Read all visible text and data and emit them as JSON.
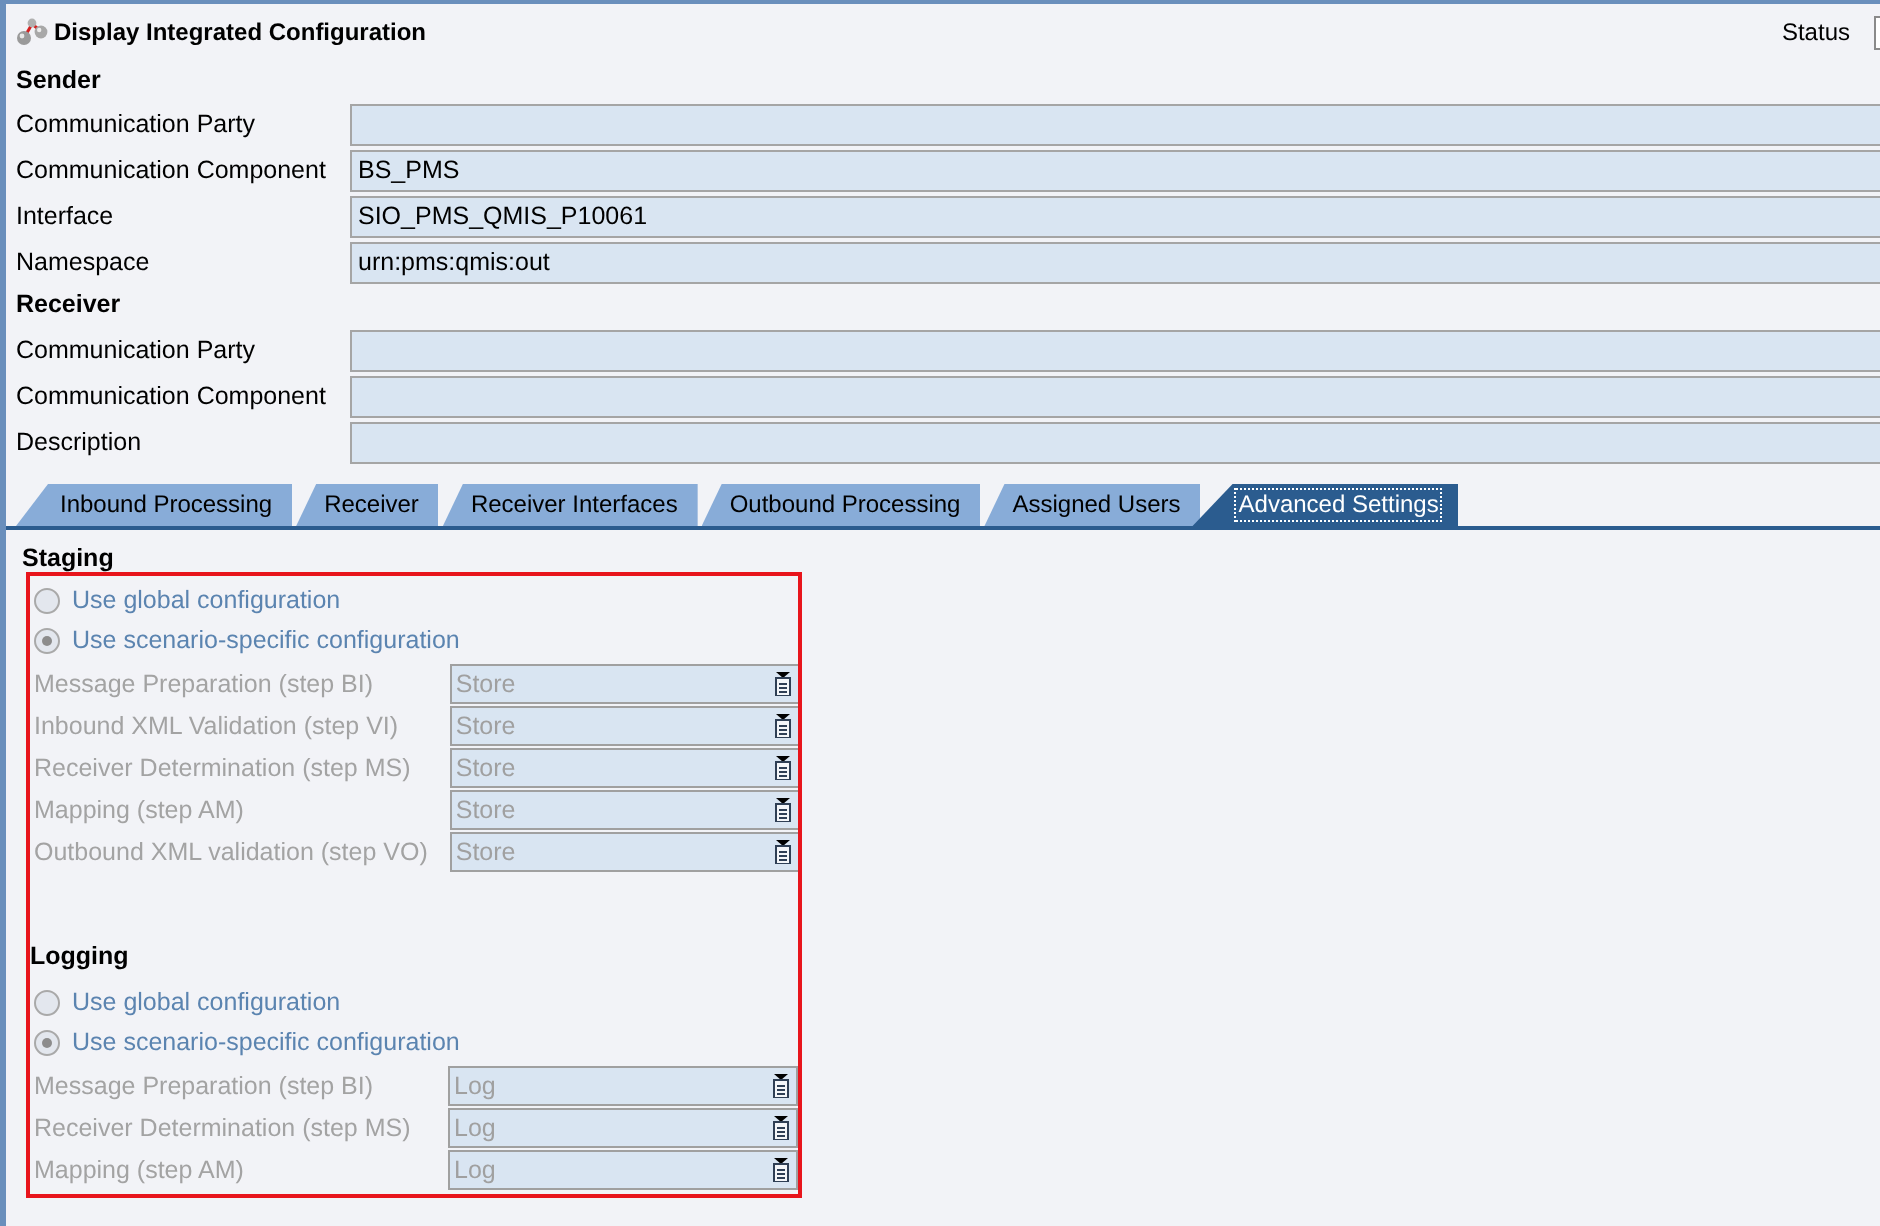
{
  "window": {
    "title": "Display Integrated Configuration",
    "status_label": "Status"
  },
  "sender": {
    "heading": "Sender",
    "fields": [
      {
        "label": "Communication Party"
      },
      {
        "label": "Communication Component",
        "value": "BS_PMS"
      },
      {
        "label": "Interface",
        "value": "SIO_PMS_QMIS_P10061"
      },
      {
        "label": "Namespace",
        "value": "urn:pms:qmis:out"
      }
    ]
  },
  "receiver": {
    "heading": "Receiver",
    "fields": [
      {
        "label": "Communication Party"
      },
      {
        "label": "Communication Component"
      },
      {
        "label": "Description"
      }
    ]
  },
  "tabs": [
    {
      "label": "Inbound Processing",
      "selected": false
    },
    {
      "label": "Receiver",
      "selected": false
    },
    {
      "label": "Receiver Interfaces",
      "selected": false
    },
    {
      "label": "Outbound Processing",
      "selected": false
    },
    {
      "label": "Assigned Users",
      "selected": false
    },
    {
      "label": "Advanced Settings",
      "selected": true
    }
  ],
  "advanced_settings": {
    "sections": [
      {
        "heading": "Staging",
        "options": [
          {
            "label": "Use global configuration",
            "selected": false,
            "disabled": true
          },
          {
            "label": "Use scenario-specific configuration",
            "selected": true,
            "disabled": true
          }
        ],
        "steps": [
          {
            "label": "Message Preparation (step BI)",
            "value": "Store",
            "disabled": true
          },
          {
            "label": "Inbound XML Validation (step VI)",
            "value": "Store",
            "disabled": true
          },
          {
            "label": "Receiver Determination (step MS)",
            "value": "Store",
            "disabled": true
          },
          {
            "label": "Mapping (step AM)",
            "value": "Store",
            "disabled": true
          },
          {
            "label": "Outbound XML validation (step VO)",
            "value": "Store",
            "disabled": true
          }
        ]
      },
      {
        "heading": "Logging",
        "options": [
          {
            "label": "Use global configuration",
            "selected": false,
            "disabled": true
          },
          {
            "label": "Use scenario-specific configuration",
            "selected": true,
            "disabled": true
          }
        ],
        "steps": [
          {
            "label": "Message Preparation (step BI)",
            "value": "Log",
            "disabled": true
          },
          {
            "label": "Receiver Determination (step MS)",
            "value": "Log",
            "disabled": true
          },
          {
            "label": "Mapping (step AM)",
            "value": "Log",
            "disabled": true
          }
        ]
      }
    ]
  }
}
